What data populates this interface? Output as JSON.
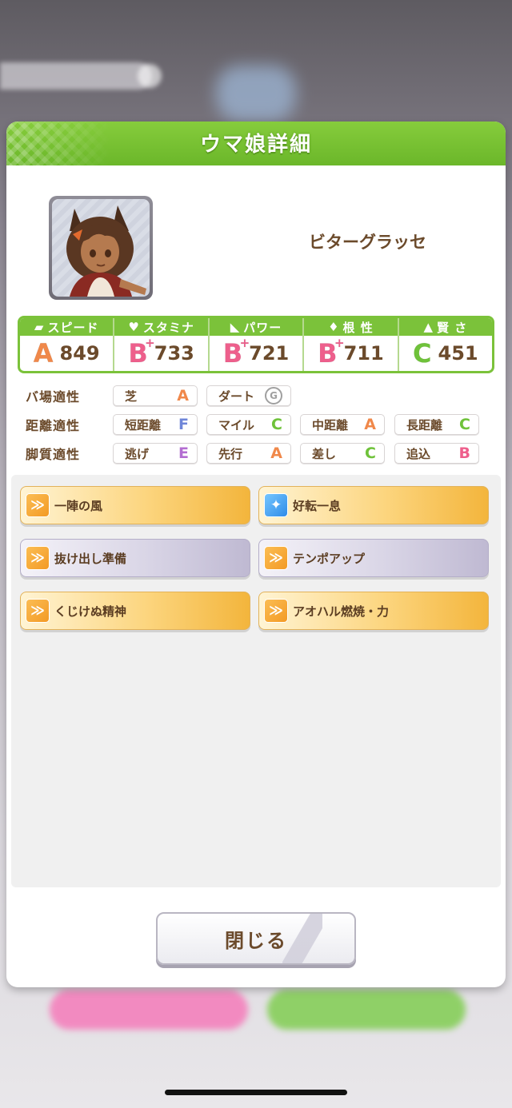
{
  "dialog": {
    "title": "ウマ娘詳細",
    "character_name": "ビターグラッセ",
    "close_label": "閉じる"
  },
  "stats": [
    {
      "label": "スピード",
      "icon": "shoe-icon",
      "rank": "A",
      "plus": "",
      "value": "849",
      "color": "#f0884a"
    },
    {
      "label": "スタミナ",
      "icon": "heart-icon",
      "rank": "B",
      "plus": "+",
      "value": "733",
      "color": "#ee5f8c"
    },
    {
      "label": "パワー",
      "icon": "muscle-icon",
      "rank": "B",
      "plus": "+",
      "value": "721",
      "color": "#ee5f8c"
    },
    {
      "label": "根 性",
      "icon": "flame-icon",
      "rank": "B",
      "plus": "+",
      "value": "711",
      "color": "#ee5f8c"
    },
    {
      "label": "賢 さ",
      "icon": "mortarboard-icon",
      "rank": "C",
      "plus": "",
      "value": "451",
      "color": "#6fc23a"
    }
  ],
  "aptitudes": {
    "track": {
      "label": "バ場適性",
      "items": [
        {
          "name": "芝",
          "grade": "A"
        },
        {
          "name": "ダート",
          "grade": "G"
        }
      ]
    },
    "distance": {
      "label": "距離適性",
      "items": [
        {
          "name": "短距離",
          "grade": "F"
        },
        {
          "name": "マイル",
          "grade": "C"
        },
        {
          "name": "中距離",
          "grade": "A"
        },
        {
          "name": "長距離",
          "grade": "C"
        }
      ]
    },
    "style": {
      "label": "脚質適性",
      "items": [
        {
          "name": "逃げ",
          "grade": "E"
        },
        {
          "name": "先行",
          "grade": "A"
        },
        {
          "name": "差し",
          "grade": "C"
        },
        {
          "name": "追込",
          "grade": "B"
        }
      ]
    }
  },
  "skills": [
    {
      "name": "一陣の風",
      "tier": "gold",
      "icon": "speed-skill-icon"
    },
    {
      "name": "好転一息",
      "tier": "gold",
      "icon": "stamina-sparkle-icon"
    },
    {
      "name": "抜け出し準備",
      "tier": "silver",
      "icon": "speed-skill-icon"
    },
    {
      "name": "テンポアップ",
      "tier": "silver",
      "icon": "speed-skill-icon"
    },
    {
      "name": "くじけぬ精神",
      "tier": "gold",
      "icon": "speed-skill-icon"
    },
    {
      "name": "アオハル燃焼・力",
      "tier": "gold",
      "icon": "speed-skill-icon"
    }
  ]
}
